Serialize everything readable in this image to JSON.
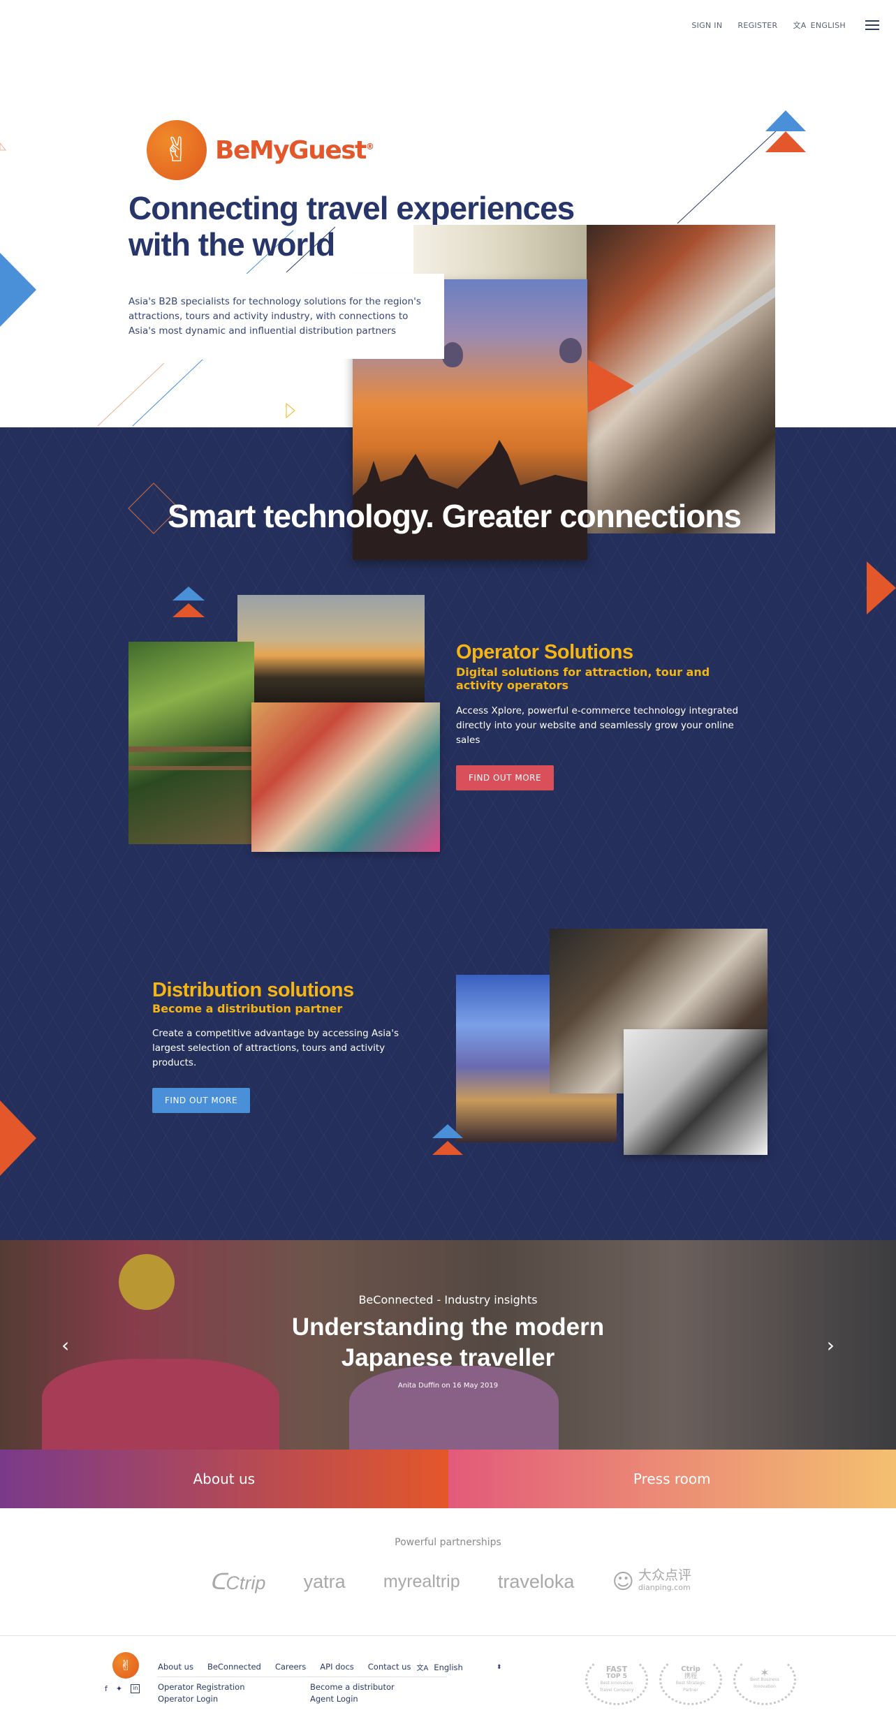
{
  "nav": {
    "sign_in": "SIGN IN",
    "register": "REGISTER",
    "language": "ENGLISH"
  },
  "brand": {
    "name": "BeMyGuest",
    "registered": "®"
  },
  "hero": {
    "title_line1": "Connecting travel experiences",
    "title_line2": "with the world",
    "description": "Asia's B2B specialists for technology solutions for the region's attractions, tours and activity industry, with connections to Asia's most dynamic and influential distribution partners"
  },
  "smart": {
    "title": "Smart technology. Greater connections"
  },
  "operator": {
    "title": "Operator Solutions",
    "subtitle": "Digital solutions for attraction, tour and activity operators",
    "description": "Access Xplore, powerful e-commerce technology integrated directly into your website and seamlessly grow your online sales",
    "cta": "FIND OUT MORE"
  },
  "distribution": {
    "title": "Distribution solutions",
    "subtitle": "Become a distribution partner",
    "description": "Create a competitive advantage by accessing Asia's largest selection of attractions, tours and activity products.",
    "cta": "FIND OUT MORE"
  },
  "carousel": {
    "kicker": "BeConnected - Industry insights",
    "title_line1": "Understanding the modern",
    "title_line2": "Japanese traveller",
    "meta": "Anita Duffin on 16 May 2019"
  },
  "bands": {
    "about": "About us",
    "press": "Press room"
  },
  "partners": {
    "heading": "Powerful partnerships",
    "logos": [
      "Ctrip",
      "yatra",
      "myrealtrip",
      "traveloka",
      "大众点评",
      "dianping.com"
    ]
  },
  "footer": {
    "links": [
      "About us",
      "BeConnected",
      "Careers",
      "API docs",
      "Contact us"
    ],
    "language": "English",
    "operator_registration": "Operator Registration",
    "operator_login": "Operator Login",
    "distributor": "Become a distributor",
    "agent_login": "Agent Login",
    "awards": [
      {
        "top": "FAST",
        "mid": "TOP 5",
        "bottom": "Best Innovative Travel Company"
      },
      {
        "top": "Ctrip",
        "mid": "携程",
        "bottom": "Best Strategic Partner"
      },
      {
        "top": "",
        "mid": "",
        "bottom": "Best Business Innovation"
      }
    ]
  },
  "colors": {
    "navy": "#252f5c",
    "title_navy": "#26356a",
    "orange": "#e4572a",
    "yellow": "#f4b515",
    "red_btn": "#d9505a",
    "blue_btn": "#4a90d9",
    "blue_tri": "#4a90d9"
  }
}
